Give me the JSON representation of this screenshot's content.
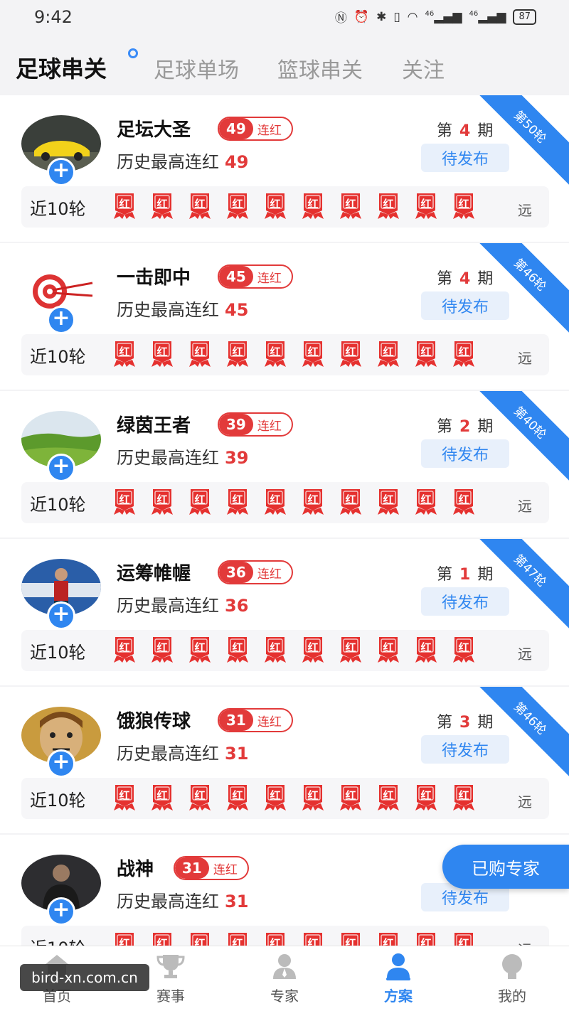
{
  "status_bar": {
    "time": "9:42",
    "network_a": "46",
    "network_b": "46",
    "battery": "87"
  },
  "tabs": [
    {
      "label": "足球串关",
      "active": true
    },
    {
      "label": "足球单场",
      "active": false
    },
    {
      "label": "篮球串关",
      "active": false
    },
    {
      "label": "关注",
      "active": false
    }
  ],
  "list": {
    "history_label": "历史最高连红",
    "recent_label": "近10轮",
    "mark_text": "红",
    "far_label": "远",
    "streak_suffix": "连红",
    "period_prefix": "第",
    "period_suffix": "期",
    "pending_label": "待发布",
    "experts": [
      {
        "name": "足坛大圣",
        "streak": "49",
        "history": "49",
        "period": "4",
        "ribbon": "第50轮",
        "avatar": "car"
      },
      {
        "name": "一击即中",
        "streak": "45",
        "history": "45",
        "period": "4",
        "ribbon": "第46轮",
        "avatar": "target"
      },
      {
        "name": "绿茵王者",
        "streak": "39",
        "history": "39",
        "period": "2",
        "ribbon": "第40轮",
        "avatar": "grassland"
      },
      {
        "name": "运筹帷幄",
        "streak": "36",
        "history": "36",
        "period": "1",
        "ribbon": "第47轮",
        "avatar": "player"
      },
      {
        "name": "饿狼传球",
        "streak": "31",
        "history": "31",
        "period": "3",
        "ribbon": "第46轮",
        "avatar": "cartoon"
      },
      {
        "name": "战神",
        "streak": "31",
        "history": "31",
        "period": "",
        "ribbon": "",
        "avatar": "person"
      }
    ]
  },
  "floating": {
    "bought_label": "已购专家"
  },
  "bottom_nav": [
    {
      "label": "首页",
      "icon": "home-icon"
    },
    {
      "label": "赛事",
      "icon": "trophy-icon"
    },
    {
      "label": "专家",
      "icon": "expert-icon"
    },
    {
      "label": "方案",
      "icon": "plan-icon",
      "active": true
    },
    {
      "label": "我的",
      "icon": "profile-icon"
    }
  ],
  "watermark": "bird-xn.com.cn",
  "colors": {
    "accent": "#2f86f0",
    "red": "#e23a3a"
  }
}
